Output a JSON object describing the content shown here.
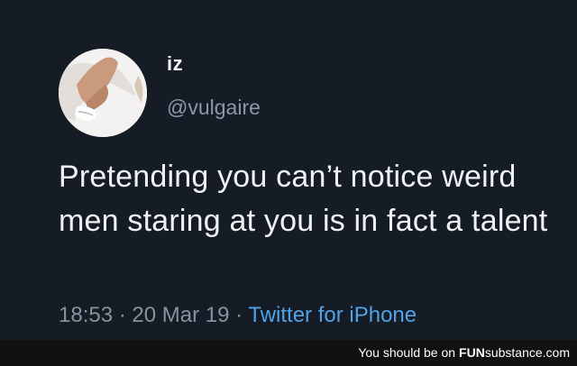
{
  "tweet": {
    "display_name": "iz",
    "handle": "@vulgaire",
    "text": "Pretending you can’t notice weird men staring at you is in fact a talent",
    "time": "18:53",
    "separator": " · ",
    "date": "20 Mar 19",
    "source": "Twitter for iPhone",
    "colors": {
      "background": "#151c26",
      "text": "#eef1f4",
      "muted": "#87919c",
      "link": "#4ea3e7"
    }
  },
  "footer": {
    "prefix": "You should be on",
    "brand_bold": "FUN",
    "brand_rest": "substance.com"
  }
}
